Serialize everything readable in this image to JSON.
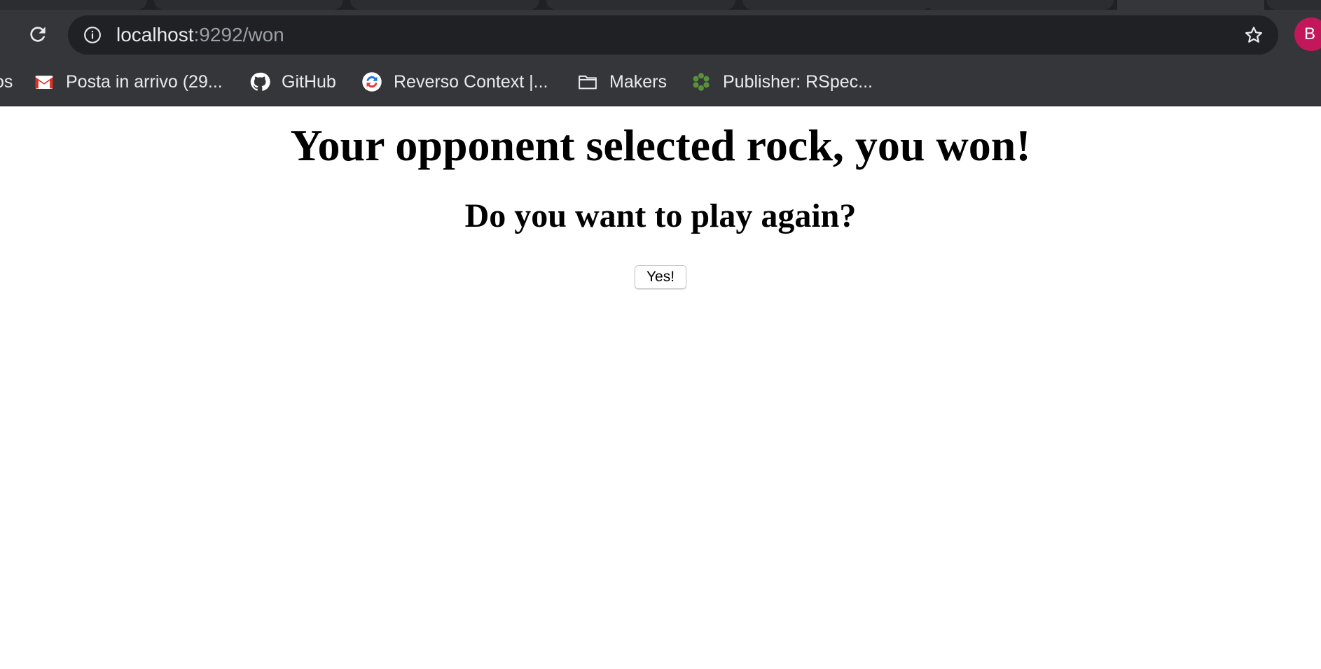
{
  "browser": {
    "url_host": "localhost",
    "url_rest": ":9292/won",
    "profile_initial": "B",
    "bookmarks": [
      {
        "label": "os",
        "icon": "apps-icon"
      },
      {
        "label": "Posta in arrivo (29...",
        "icon": "gmail-icon"
      },
      {
        "label": "GitHub",
        "icon": "github-icon"
      },
      {
        "label": "Reverso Context |...",
        "icon": "reverso-icon"
      },
      {
        "label": "Makers",
        "icon": "folder-icon"
      },
      {
        "label": "Publisher: RSpec...",
        "icon": "publisher-icon"
      }
    ]
  },
  "page": {
    "heading": "Your opponent selected rock, you won!",
    "subheading": "Do you want to play again?",
    "yes_button_label": "Yes!"
  },
  "colors": {
    "chrome_bg": "#35363a",
    "omnibox_bg": "#202124",
    "avatar_bg": "#c2185b",
    "gmail_red": "#d93025"
  }
}
